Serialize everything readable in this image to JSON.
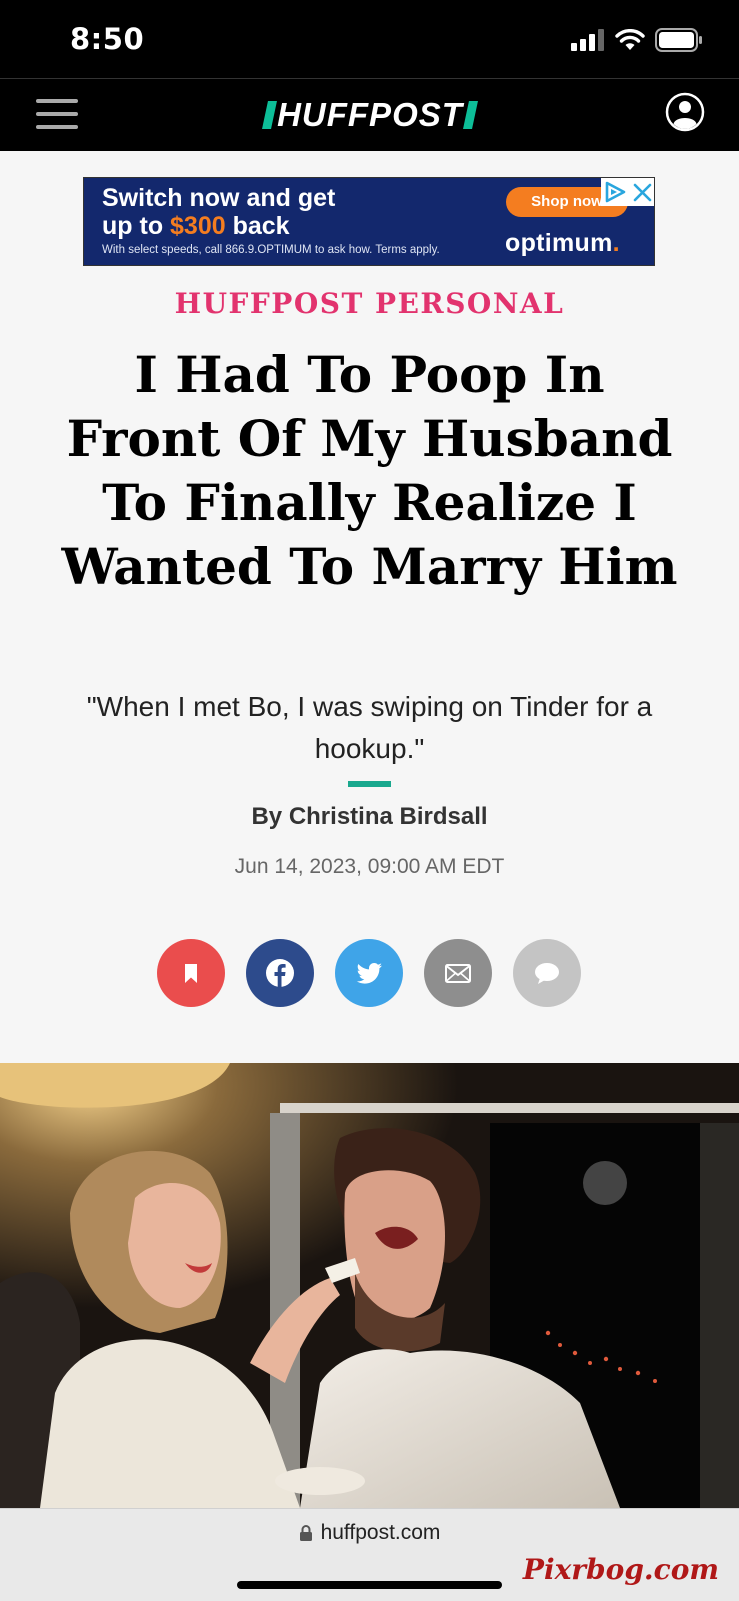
{
  "status_bar": {
    "time": "8:50"
  },
  "site": {
    "logo_text": "HUFFPOST"
  },
  "ad": {
    "headline_line1": "Switch now and get",
    "headline_line2_prefix": "up to ",
    "headline_amount": "$300",
    "headline_line2_suffix": " back",
    "fineprint": "With select speeds, call 866.9.OPTIMUM to ask how. Terms apply.",
    "cta": "Shop now",
    "brand": "optimum",
    "brand_dot": "."
  },
  "article": {
    "kicker": "HUFFPOST PERSONAL",
    "headline": "I Had To Poop In Front Of My Husband To Finally Realize I Wanted To Marry Him",
    "dek": "\"When I met Bo, I was swiping on Tinder for a hookup.\"",
    "byline_prefix": "By ",
    "author": "Christina Birdsall",
    "timestamp": "Jun 14, 2023, 09:00 AM EDT"
  },
  "share": {
    "icons": [
      "bookmark-icon",
      "facebook-icon",
      "twitter-icon",
      "email-icon",
      "comment-icon"
    ],
    "colors": {
      "bookmark": "#ea4d4d",
      "facebook": "#2d4b8c",
      "twitter": "#3fa4e8",
      "email": "#8e8e8e",
      "comment": "#c4c4c4"
    }
  },
  "browser": {
    "url": "huffpost.com"
  },
  "watermark": "Pixrbog.com",
  "colors": {
    "accent_pink": "#e2336e",
    "logo_green": "#0dbe98",
    "ad_navy": "#13286d",
    "ad_orange": "#f47d20"
  }
}
